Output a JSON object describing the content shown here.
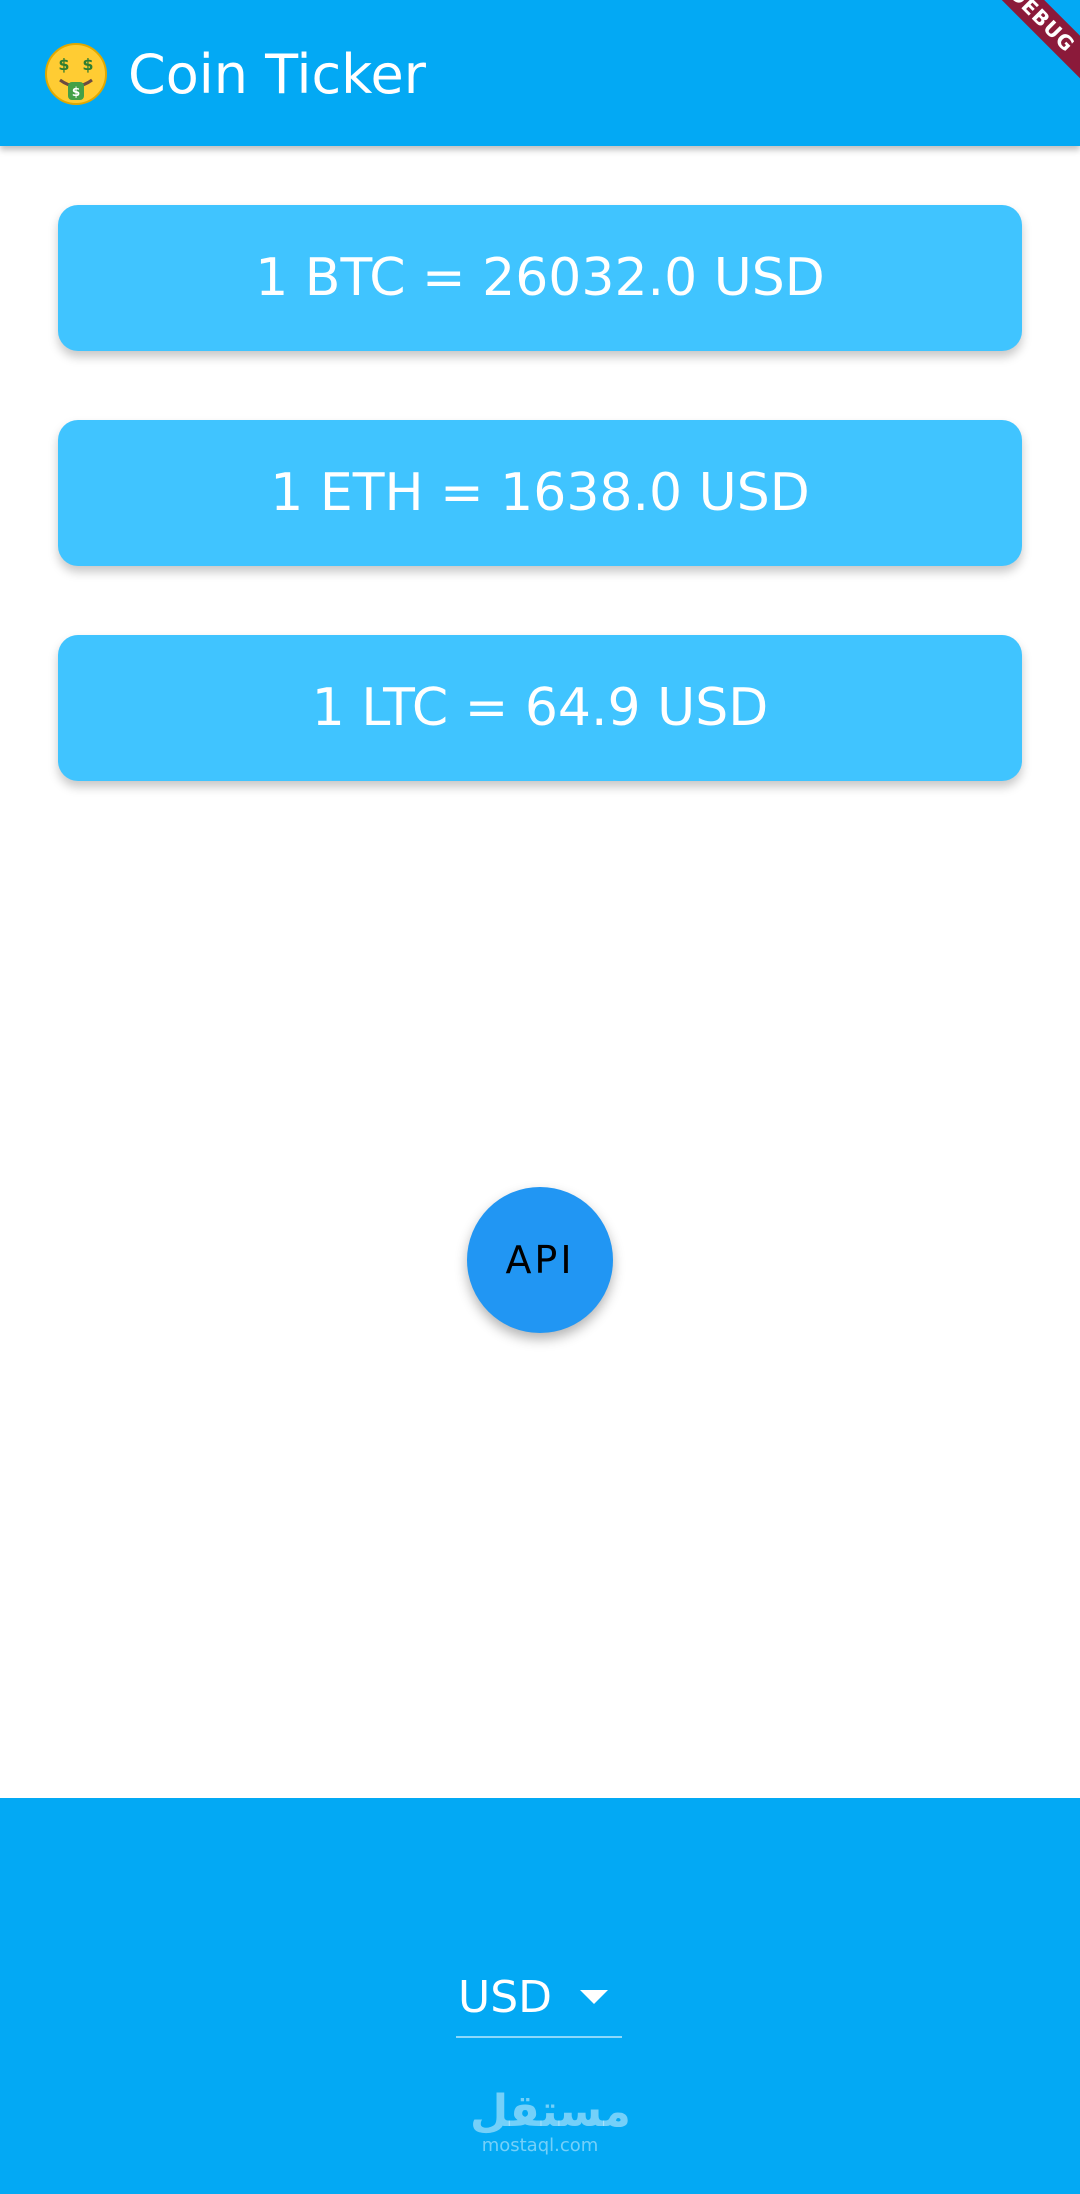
{
  "app_bar": {
    "title": "Coin Ticker",
    "emoji_icon": "money-mouth-face-icon",
    "debug_banner": "DEBUG"
  },
  "rates": [
    {
      "text": "1 BTC = 26032.0 USD"
    },
    {
      "text": "1 ETH = 1638.0 USD"
    },
    {
      "text": "1 LTC = 64.9 USD"
    }
  ],
  "fab": {
    "label": "API"
  },
  "currency_picker": {
    "selected": "USD",
    "icon": "dropdown-arrow-icon"
  },
  "watermark": {
    "arabic": "مستقل",
    "latin": "mostaql.com"
  },
  "colors": {
    "primary": "#03A9F4",
    "card": "#40C4FF",
    "fab": "#2196F3",
    "debug": "#8B1A3A"
  }
}
